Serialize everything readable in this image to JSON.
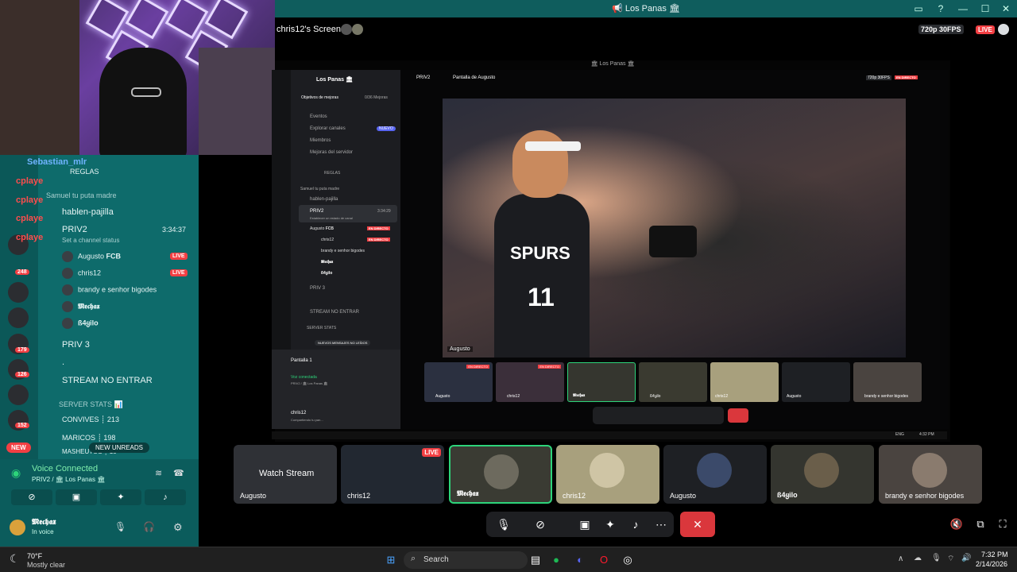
{
  "window": {
    "title": "📢 Los Panas 🏛"
  },
  "stream": {
    "title": "chris12's Screen",
    "quality": "720p 30FPS",
    "live": "LIVE"
  },
  "chat_overlay": [
    {
      "name": "Sebastian_mlr",
      "color": "#6fb3ff"
    },
    {
      "name": "cplaye",
      "color": "#ff4d4d"
    },
    {
      "name": "cplaye",
      "color": "#ff4d4d"
    },
    {
      "name": "cplaye",
      "color": "#ff4d4d"
    },
    {
      "name": "cplaye",
      "color": "#ff4d4d"
    }
  ],
  "sidebar": {
    "reglas": "REGLAS",
    "category1": "Samuel tu puta madre",
    "channel1": "hablen-pajilla",
    "channel2": "PRIV2",
    "channel2_time": "3:34:37",
    "channel_status": "Set a channel status",
    "members": [
      {
        "name": "Augusto",
        "tag": "FCB",
        "live": "LIVE"
      },
      {
        "name": "chris12",
        "tag": "",
        "live": "LIVE"
      },
      {
        "name": "brandy e senhor bigodes",
        "tag": "",
        "live": ""
      },
      {
        "name": "𝕸𝖊𝖈𝖍𝖆𝖝",
        "tag": "",
        "live": ""
      },
      {
        "name": "ß4ყilo",
        "tag": "",
        "live": ""
      }
    ],
    "channel3": "PRIV 3",
    "channel4": ".",
    "channel5": "STREAM NO ENTRAR",
    "category2": "SERVER STATS 📊",
    "stat1": "CONVIVES ┊ 213",
    "stat2": "MARICOS ┊ 198",
    "stat3": "MASHEUTOS ┊ 15",
    "new_unreads": "NEW UNREADS",
    "new_badge": "NEW",
    "guild_badges": [
      "248",
      "179",
      "126",
      "152"
    ]
  },
  "voice": {
    "status": "Voice Connected",
    "location": "PRIV2 / 🏛 Los Panas 🏛",
    "user": "𝕸𝖊𝖈𝖍𝖆𝖝",
    "user_status": "In voice"
  },
  "inner": {
    "title": "🏛 Los Panas 🏛",
    "server": "Los Panas 🏛",
    "goals": "Objetivos de mejoras",
    "goals_count": "0/36 Mejoras",
    "menu": [
      "Eventos",
      "Explorar canales",
      "Miembros",
      "Mejoras del servidor"
    ],
    "nuevo": "NUEVO",
    "reglas": "REGLAS",
    "category": "Samuel tu puta madre",
    "channel1": "hablen-pajilla",
    "channel2": "PRIV2",
    "channel2_time": "3:34:29",
    "channel2_status": "Establecer un estado de canal",
    "members": [
      {
        "name": "Augusto",
        "tag": "FCB",
        "live": "EN DIRECTO"
      },
      {
        "name": "chris12",
        "tag": "",
        "live": "EN DIRECTO"
      },
      {
        "name": "brandy e senhor bigodes",
        "tag": "",
        "live": ""
      },
      {
        "name": "𝕸𝖊𝖈𝖍𝖆𝖝",
        "tag": "",
        "live": ""
      },
      {
        "name": "ß4ყilo",
        "tag": "",
        "live": ""
      }
    ],
    "channel3": "PRIV 3",
    "channel5": "STREAM NO ENTRAR",
    "category2": "SERVER STATS",
    "new_msgs": "NUEVOS MENSAJES NO LEÍDOS",
    "pantalla": "Pantalla 1",
    "voice": "Voz conectada",
    "voice_loc": "PRIV2 / 🏛 Los Panas 🏛",
    "user": "chris12",
    "user_status": "Compartiendo tu pan...",
    "header_channel": "PRIV2",
    "header_stream": "Pantalla de Augusto",
    "quality": "720p 30FPS",
    "live": "EN DIRECTO",
    "video_label": "Augusto",
    "jersey_team": "SPURS",
    "jersey_number": "11",
    "thumbs": [
      {
        "name": "Augusto",
        "live": "EN DIRECTO"
      },
      {
        "name": "chris12",
        "live": "EN DIRECTO"
      },
      {
        "name": "𝕸𝖊𝖈𝖍𝖆𝖝",
        "live": ""
      },
      {
        "name": "ß4ყilo",
        "live": ""
      },
      {
        "name": "chris12",
        "live": ""
      },
      {
        "name": "Augusto",
        "live": ""
      },
      {
        "name": "brandy e senhor bigodes",
        "live": ""
      }
    ],
    "taskbar_lang": "ENG",
    "taskbar_time": "4:32 PM"
  },
  "tiles": [
    {
      "name": "Augusto",
      "action": "Watch Stream",
      "live": ""
    },
    {
      "name": "chris12",
      "action": "",
      "live": "LIVE"
    },
    {
      "name": "𝕸𝖊𝖈𝖍𝖆𝖝",
      "action": "",
      "live": ""
    },
    {
      "name": "chris12",
      "action": "",
      "live": ""
    },
    {
      "name": "Augusto",
      "action": "",
      "live": ""
    },
    {
      "name": "ß4ყilo",
      "action": "",
      "live": ""
    },
    {
      "name": "brandy e senhor bigodes",
      "action": "",
      "live": ""
    }
  ],
  "taskbar": {
    "weather_temp": "70°F",
    "weather_desc": "Mostly clear",
    "search": "Search",
    "time": "7:32 PM",
    "date": "2/14/2026"
  }
}
